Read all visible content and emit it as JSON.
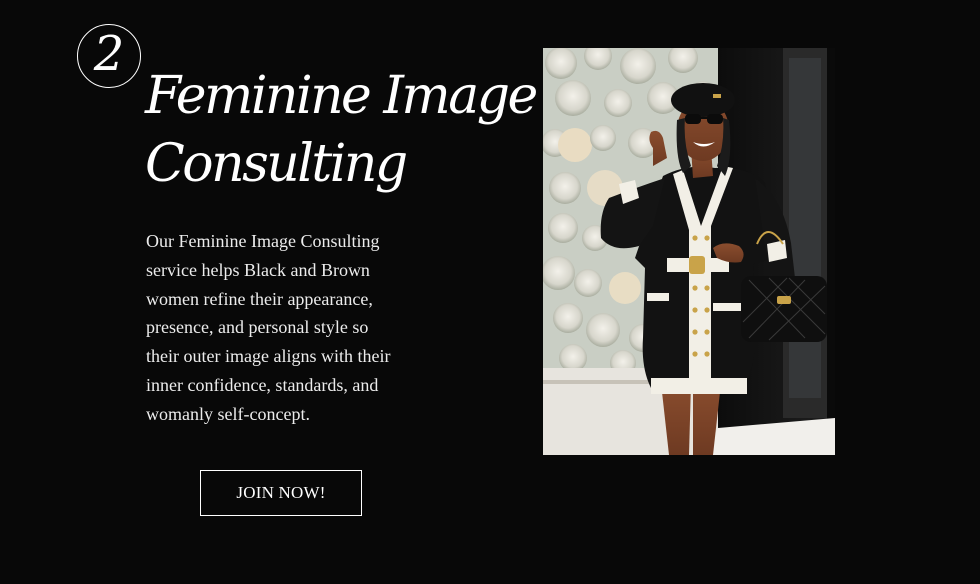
{
  "step": {
    "number": "2"
  },
  "headline": {
    "line1": "Feminine Image",
    "line2": "Consulting"
  },
  "description": {
    "lines": [
      "Our Feminine Image Consulting",
      "service helps Black and Brown",
      "women refine their appearance,",
      "presence, and personal style so",
      "their outer image aligns with their",
      "inner confidence, standards, and",
      "womanly self-concept."
    ]
  },
  "cta": {
    "label": "JOIN NOW!"
  },
  "colors": {
    "background": "#080808",
    "text": "#ffffff",
    "outfit_black": "#111111",
    "outfit_trim": "#f2efe6",
    "flower_wall": "#d9ddd5"
  }
}
